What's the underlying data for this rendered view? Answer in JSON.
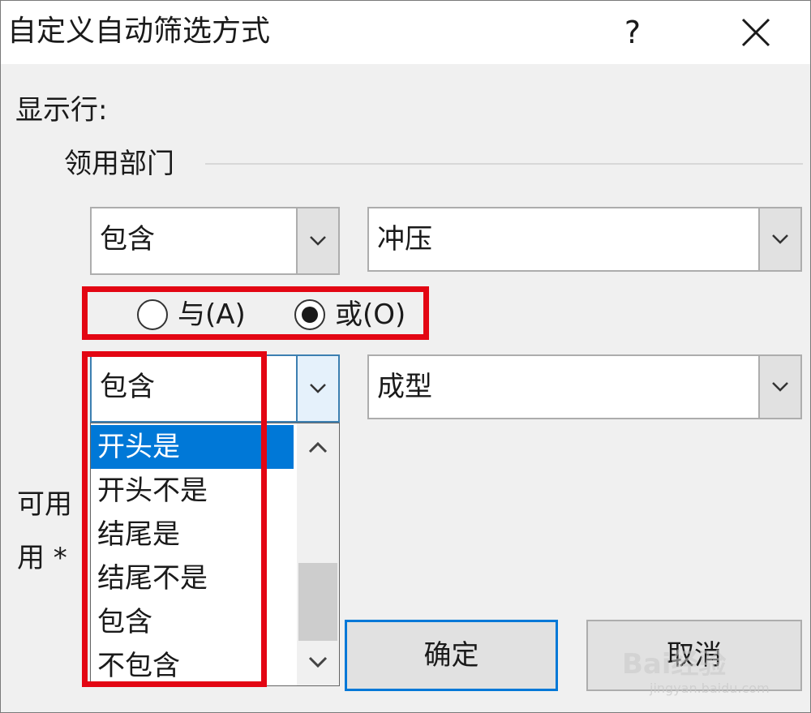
{
  "dialog": {
    "title": "自定义自动筛选方式",
    "help_label": "?",
    "show_rows_label": "显示行:",
    "field_name": "领用部门"
  },
  "condition1": {
    "operator": "包含",
    "value": "冲压"
  },
  "logic": {
    "and_label": "与(A)",
    "or_label": "或(O)",
    "selected": "or"
  },
  "condition2": {
    "operator": "包含",
    "value": "成型"
  },
  "dropdown_options": [
    "开头是",
    "开头不是",
    "结尾是",
    "结尾不是",
    "包含",
    "不包含"
  ],
  "dropdown_highlighted": "开头是",
  "hints": {
    "line1": "可用",
    "line2": "用 *"
  },
  "buttons": {
    "ok": "确定",
    "cancel": "取消"
  },
  "watermark": {
    "brand": "Bai经验",
    "url": "jingyan.baidu.com"
  },
  "colors": {
    "selection": "#0078d7",
    "highlight_box": "#e30613"
  }
}
